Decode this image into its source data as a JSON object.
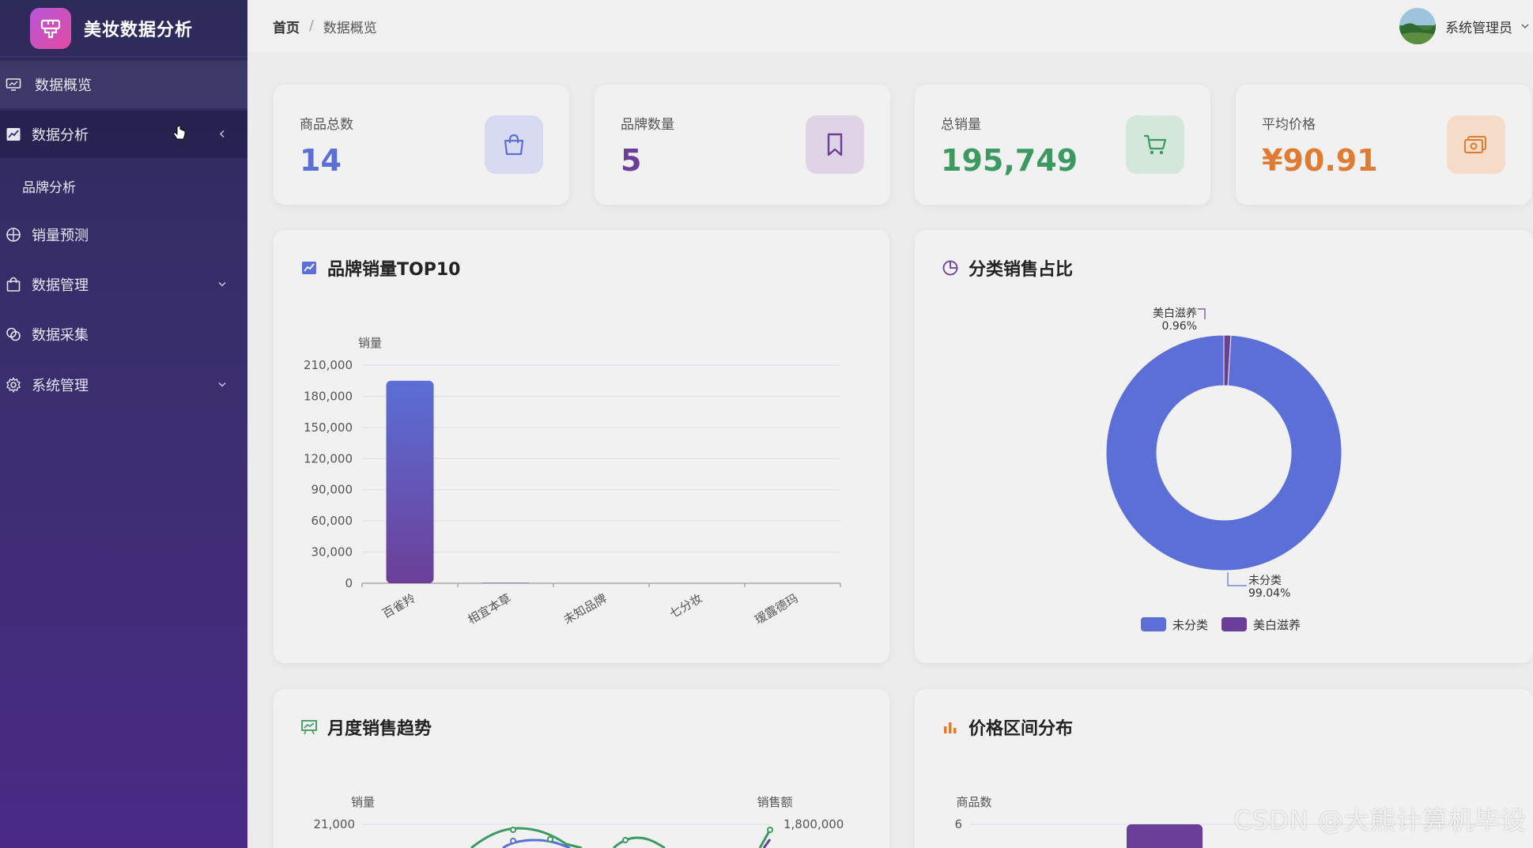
{
  "app": {
    "title": "美妆数据分析"
  },
  "sidebar": {
    "items": [
      {
        "label": "数据概览",
        "icon": "monitor-icon"
      },
      {
        "label": "数据分析",
        "icon": "chart-line-icon"
      },
      {
        "label": "品牌分析"
      },
      {
        "label": "销量预测",
        "icon": "crosshair-icon"
      },
      {
        "label": "数据管理",
        "icon": "bag-icon"
      },
      {
        "label": "数据采集",
        "icon": "coins-icon"
      },
      {
        "label": "系统管理",
        "icon": "gear-icon"
      }
    ]
  },
  "header": {
    "breadcrumb": {
      "home": "首页",
      "separator": "/",
      "current": "数据概览"
    },
    "user": {
      "name": "系统管理员"
    }
  },
  "stats": [
    {
      "label": "商品总数",
      "value": "14",
      "color": "#5b6fd6",
      "icon": "shopping-bag-icon",
      "icon_bg": "#d7daf1"
    },
    {
      "label": "品牌数量",
      "value": "5",
      "color": "#6b3f98",
      "icon": "bookmark-icon",
      "icon_bg": "#ded4e6"
    },
    {
      "label": "总销量",
      "value": "195,749",
      "color": "#3c9a61",
      "icon": "cart-icon",
      "icon_bg": "#d3e8da"
    },
    {
      "label": "平均价格",
      "value": "¥90.91",
      "color": "#e07b32",
      "icon": "money-icon",
      "icon_bg": "#f4dcc9"
    }
  ],
  "panels": {
    "brand_top10": {
      "title": "品牌销量TOP10"
    },
    "category_share": {
      "title": "分类销售占比"
    },
    "monthly_trend": {
      "title": "月度销售趋势"
    },
    "price_range": {
      "title": "价格区间分布"
    }
  },
  "chart_data": [
    {
      "type": "bar",
      "title": "品牌销量TOP10",
      "ylabel": "销量",
      "categories": [
        "百雀羚",
        "相宜本草",
        "未知品牌",
        "七分妆",
        "瑷露德玛"
      ],
      "values": [
        195000,
        500,
        0,
        0,
        0
      ],
      "ylim": [
        0,
        210000
      ],
      "yticks": [
        "0",
        "30,000",
        "60,000",
        "90,000",
        "120,000",
        "150,000",
        "180,000",
        "210,000"
      ],
      "colors": [
        "#5b6fd6",
        "#6b3f98"
      ]
    },
    {
      "type": "pie",
      "title": "分类销售占比",
      "slices": [
        {
          "name": "未分类",
          "value": 99.04,
          "label": "99.04%",
          "color": "#5b6fd6"
        },
        {
          "name": "美白滋养",
          "value": 0.96,
          "label": "0.96%",
          "color": "#6b3f98"
        }
      ],
      "legend": "bottom"
    },
    {
      "type": "line",
      "title": "月度销售趋势",
      "ylabel": "销量",
      "y2label": "销售额",
      "yticks_visible": [
        "21,000"
      ],
      "y2ticks_visible": [
        "1,800,000"
      ]
    },
    {
      "type": "bar",
      "title": "价格区间分布",
      "ylabel": "商品数",
      "yticks_visible": [
        "6"
      ]
    }
  ],
  "watermark": "CSDN @大熊计算机毕设"
}
